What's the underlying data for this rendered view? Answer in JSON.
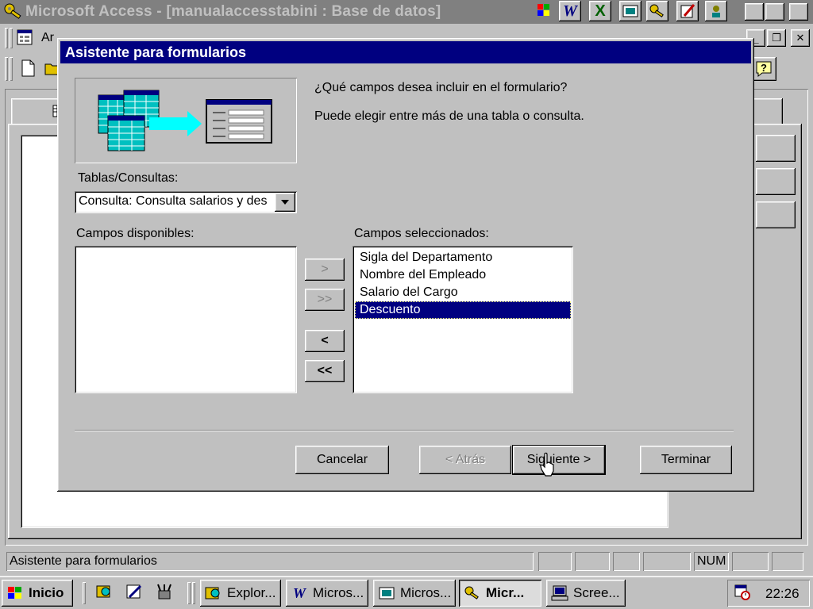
{
  "app": {
    "title": "Microsoft Access - [manualaccesstabini : Base de datos]",
    "menu_visible_fragment": "Ar"
  },
  "dialog": {
    "title": "Asistente para formularios",
    "question": "¿Qué campos desea incluir en el formulario?",
    "hint": "Puede elegir entre más de una tabla o consulta.",
    "tables_label": "Tablas/Consultas:",
    "tables_selected": "Consulta: Consulta salarios y des",
    "available_label": "Campos disponibles:",
    "selected_label": "Campos seleccionados:",
    "available_fields": [],
    "selected_fields": [
      "Sigla del Departamento",
      "Nombre del Empleado",
      "Salario del Cargo",
      "Descuento"
    ],
    "selected_index": 3,
    "move_buttons": {
      "add_one": ">",
      "add_all": ">>",
      "remove_one": "<",
      "remove_all": "<<"
    },
    "buttons": {
      "cancel": "Cancelar",
      "back": "< Atrás",
      "next": "Siguiente >",
      "finish": "Terminar"
    }
  },
  "statusbar": {
    "text": "Asistente para formularios",
    "num": "NUM"
  },
  "taskbar": {
    "start": "Inicio",
    "tasks": [
      "Explor...",
      "Micros...",
      "Micros...",
      "Micr...",
      "Scree..."
    ],
    "active_index": 3,
    "clock": "22:26"
  },
  "colors": {
    "titlebar_active": "#000080",
    "titlebar_inactive": "#808080",
    "face": "#c0c0c0",
    "selection": "#000080"
  }
}
